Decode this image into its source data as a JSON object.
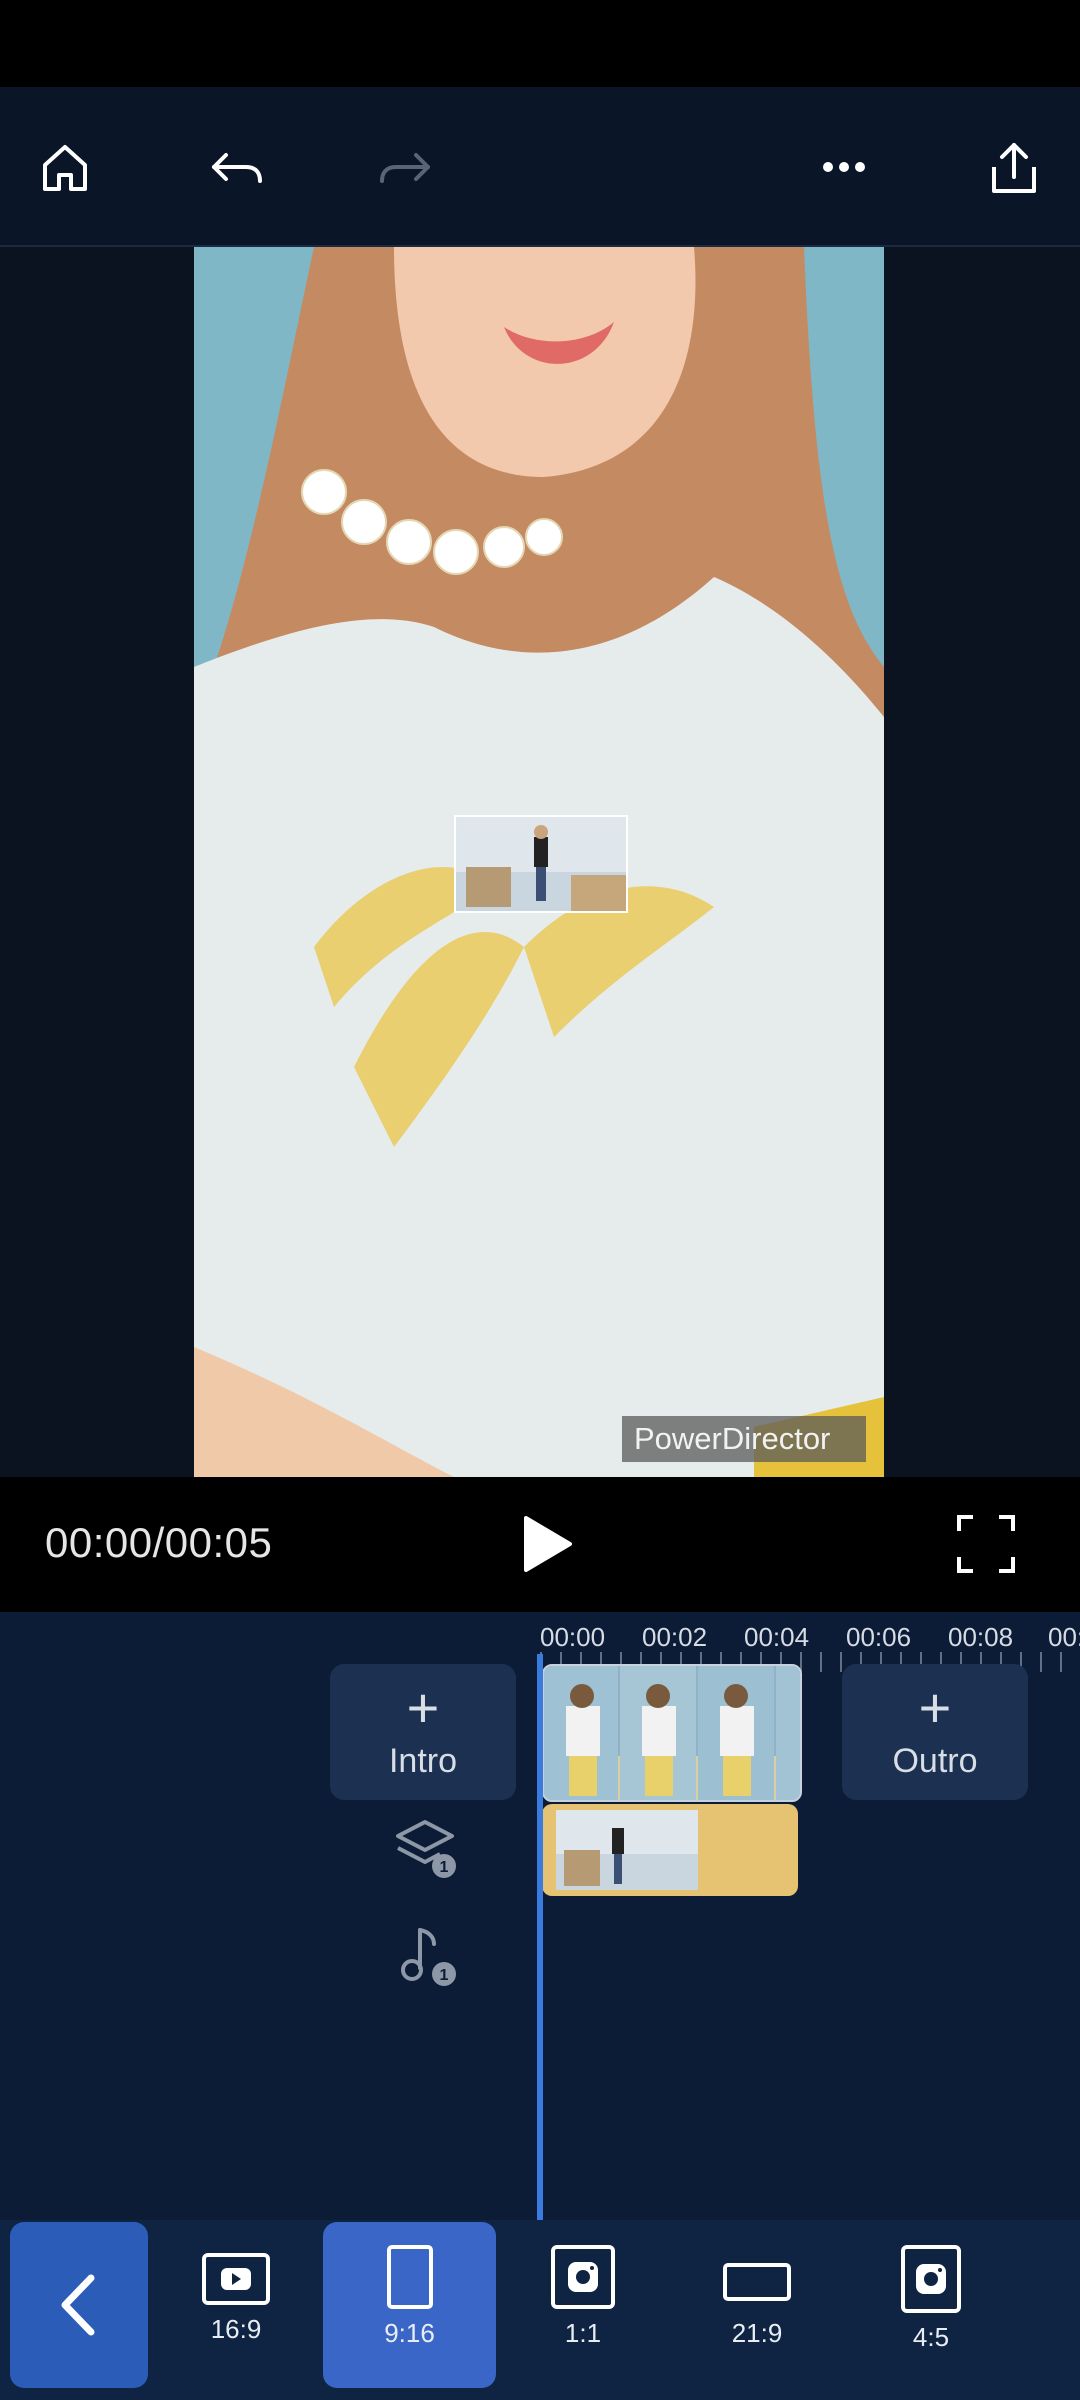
{
  "toolbar": {
    "home": "home-icon",
    "undo": "undo-icon",
    "redo": "redo-icon",
    "more": "more-icon",
    "share": "share-icon"
  },
  "preview": {
    "watermark": "PowerDirector"
  },
  "playback": {
    "timecode": "00:00/00:05"
  },
  "timeline": {
    "ticks": [
      "00:00",
      "00:02",
      "00:04",
      "00:06",
      "00:08",
      "00:"
    ],
    "intro_label": "Intro",
    "outro_label": "Outro",
    "layer_count": "1",
    "music_count": "1"
  },
  "ratios": [
    {
      "label": "16:9"
    },
    {
      "label": "9:16"
    },
    {
      "label": "1:1"
    },
    {
      "label": "21:9"
    },
    {
      "label": "4:5"
    }
  ],
  "colors": {
    "accent": "#3a67c7",
    "playhead": "#3a7be0",
    "layer_clip": "#e6c372"
  }
}
